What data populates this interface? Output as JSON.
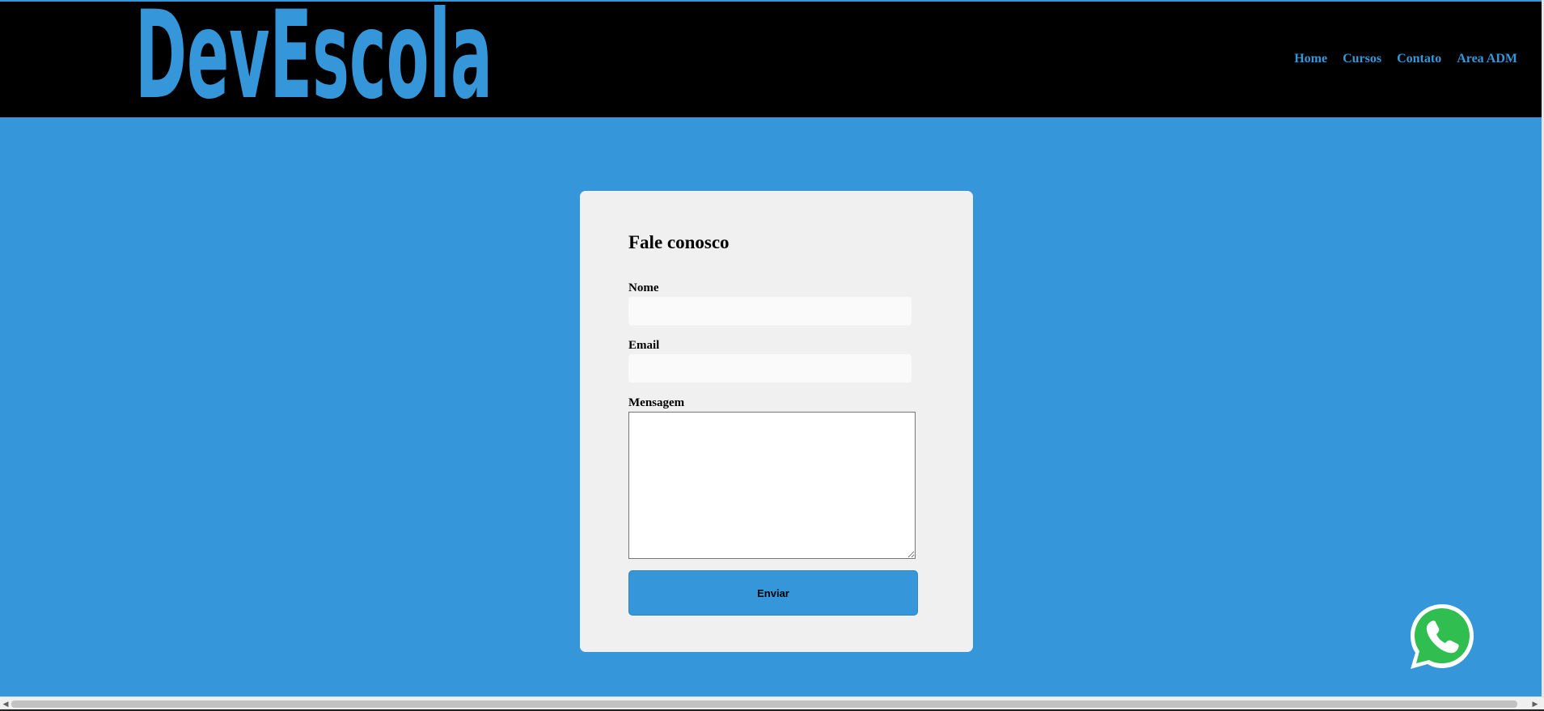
{
  "brand": {
    "logo_text": "DevEscola",
    "color": "#3597da"
  },
  "nav": {
    "items": [
      {
        "label": "Home"
      },
      {
        "label": "Cursos"
      },
      {
        "label": "Contato"
      },
      {
        "label": "Area ADM"
      }
    ]
  },
  "form": {
    "title": "Fale conosco",
    "name_label": "Nome",
    "name_value": "",
    "email_label": "Email",
    "email_value": "",
    "message_label": "Mensagem",
    "message_value": "",
    "submit_label": "Enviar"
  },
  "whatsapp": {
    "icon": "whatsapp-icon",
    "color": "#25d366"
  },
  "colors": {
    "page_background": "#3597da",
    "header_background": "#000000",
    "card_background": "#f0f0f0"
  }
}
